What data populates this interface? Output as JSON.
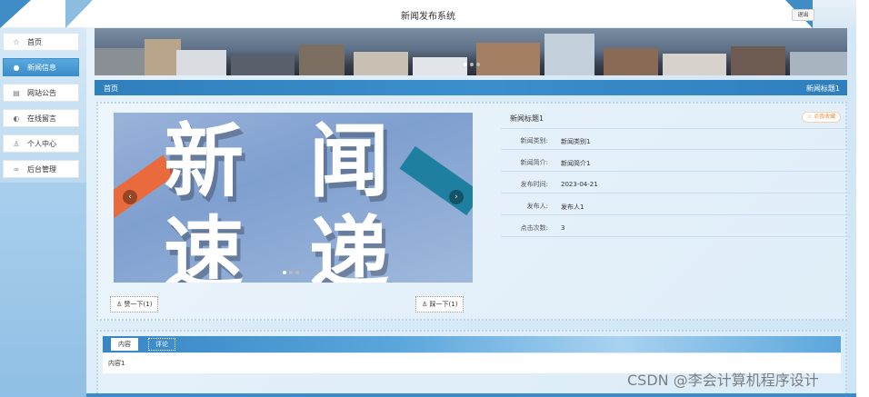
{
  "app": {
    "title": "新闻发布系统",
    "logout_label": "退出"
  },
  "sidebar": {
    "items": [
      {
        "icon": "star-icon",
        "glyph": "☆",
        "label": "首页"
      },
      {
        "icon": "news-icon",
        "glyph": "●",
        "label": "新闻信息"
      },
      {
        "icon": "notice-icon",
        "glyph": "▤",
        "label": "网站公告"
      },
      {
        "icon": "message-icon",
        "glyph": "◐",
        "label": "在线留言"
      },
      {
        "icon": "user-icon",
        "glyph": "♙",
        "label": "个人中心"
      },
      {
        "icon": "link-icon",
        "glyph": "∞",
        "label": "后台管理"
      }
    ]
  },
  "breadcrumb": {
    "home": "首页",
    "current": "新闻标题1"
  },
  "carousel": {
    "chars": [
      "新",
      "闻",
      "速",
      "递"
    ],
    "prev_icon": "‹",
    "next_icon": "›"
  },
  "detail": {
    "title": "新闻标题1",
    "favorite_label": "☆ 点我收藏",
    "fields": [
      {
        "key": "新闻类别:",
        "value": "新闻类别1"
      },
      {
        "key": "新闻简介:",
        "value": "新闻简介1"
      },
      {
        "key": "发布时间:",
        "value": "2023-04-21"
      },
      {
        "key": "发布人:",
        "value": "发布人1"
      },
      {
        "key": "点击次数:",
        "value": "3"
      }
    ],
    "like_label": "赞一下(1)",
    "dislike_label": "踩一下(1)"
  },
  "tabs": {
    "items": [
      "内容",
      "评论"
    ],
    "active": 0,
    "content": "内容1"
  },
  "watermark": "CSDN @李会计算机程序设计"
}
